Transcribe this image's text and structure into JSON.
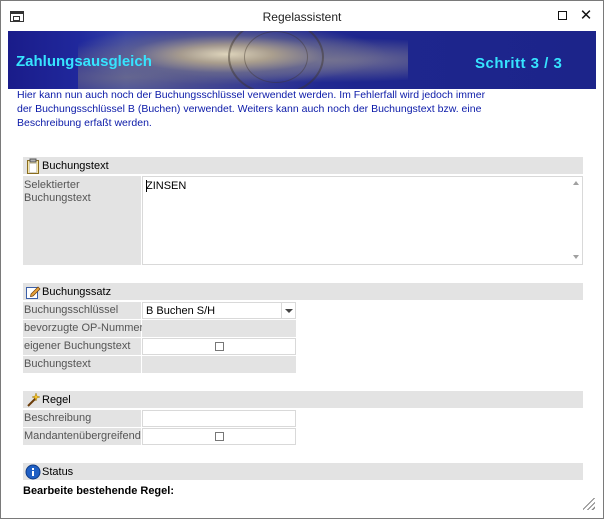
{
  "window": {
    "title": "Regelassistent",
    "close_symbol": "✕"
  },
  "banner": {
    "title": "Zahlungsausgleich",
    "step": "Schritt  3 /  3"
  },
  "intro": {
    "text": "Hier kann nun auch noch der Buchungsschlüssel verwendet werden. Im Fehlerfall wird jedoch immer der Buchungsschlüssel B (Buchen) verwendet. Weiters kann auch noch der Buchungstext bzw. eine Beschreibung erfaßt werden."
  },
  "sections": {
    "buchungstext": {
      "header": "Buchungstext",
      "icon": "clipboard-icon",
      "label": "Selektierter Buchungstext",
      "value": "ZINSEN"
    },
    "buchungssatz": {
      "header": "Buchungssatz",
      "icon": "edit-icon",
      "rows": [
        {
          "label": "Buchungsschlüssel",
          "value": "B Buchen S/H"
        },
        {
          "label": "bevorzugte OP-Nummer",
          "value": ""
        },
        {
          "label": "eigener Buchungstext",
          "checked": false
        },
        {
          "label": "Buchungstext",
          "value": ""
        }
      ]
    },
    "regel": {
      "header": "Regel",
      "icon": "wand-icon",
      "rows": [
        {
          "label": "Beschreibung",
          "value": ""
        },
        {
          "label": "Mandantenübergreifend",
          "checked": false
        }
      ]
    },
    "status": {
      "header": "Status",
      "icon": "info-icon",
      "text": "Bearbeite bestehende Regel:"
    }
  }
}
